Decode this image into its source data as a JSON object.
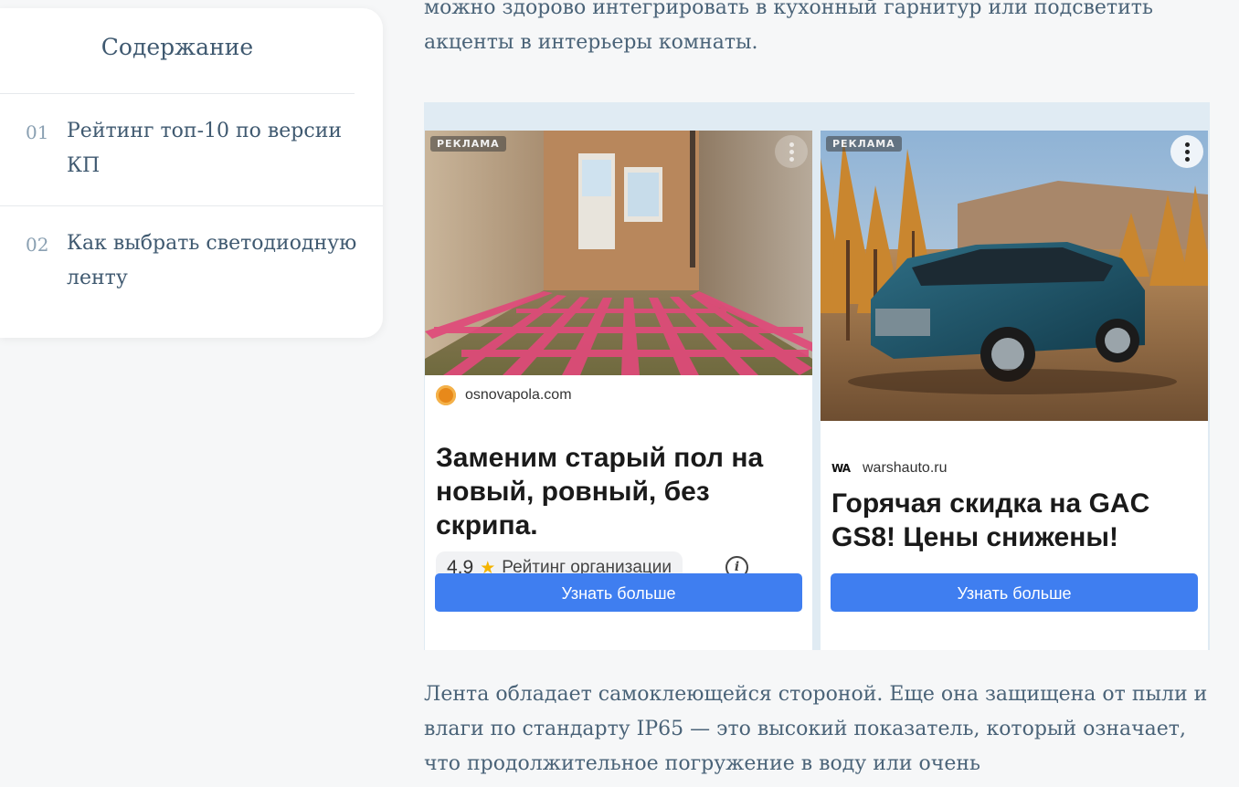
{
  "toc": {
    "title": "Содержание",
    "items": [
      {
        "num": "01",
        "label": "Рейтинг топ-10 по версии КП"
      },
      {
        "num": "02",
        "label": "Как выбрать светодиодную ленту"
      }
    ]
  },
  "article": {
    "para_top": "можно здорово интегрировать в кухонный гарнитур или подсветить акценты в интерьеры комнаты.",
    "para_bottom": "Лента обладает самоклеющейся стороной. Еще она защищена от пыли и влаги по стандарту IP65 — это высокий показатель, который означает, что продолжительное погружение в воду или очень"
  },
  "ads": [
    {
      "label": "РЕКЛАМА",
      "domain": "osnovapola.com",
      "favicon": "osnovapola-logo-icon",
      "headline": "Заменим старый пол на новый, ровный, без скрипа.",
      "rating_value": "4,9",
      "rating_text": "Рейтинг организации",
      "cta": "Узнать больше"
    },
    {
      "label": "РЕКЛАМА",
      "domain": "warshauto.ru",
      "favicon": "warshauto-logo-icon",
      "favicon_text": "WA",
      "headline": "Горячая скидка на GAC GS8! Цены снижены!",
      "cta": "Узнать больше"
    }
  ],
  "colors": {
    "accent_button": "#3f7ef0",
    "ad_background": "#e0ebf3",
    "text": "#4a6378"
  }
}
